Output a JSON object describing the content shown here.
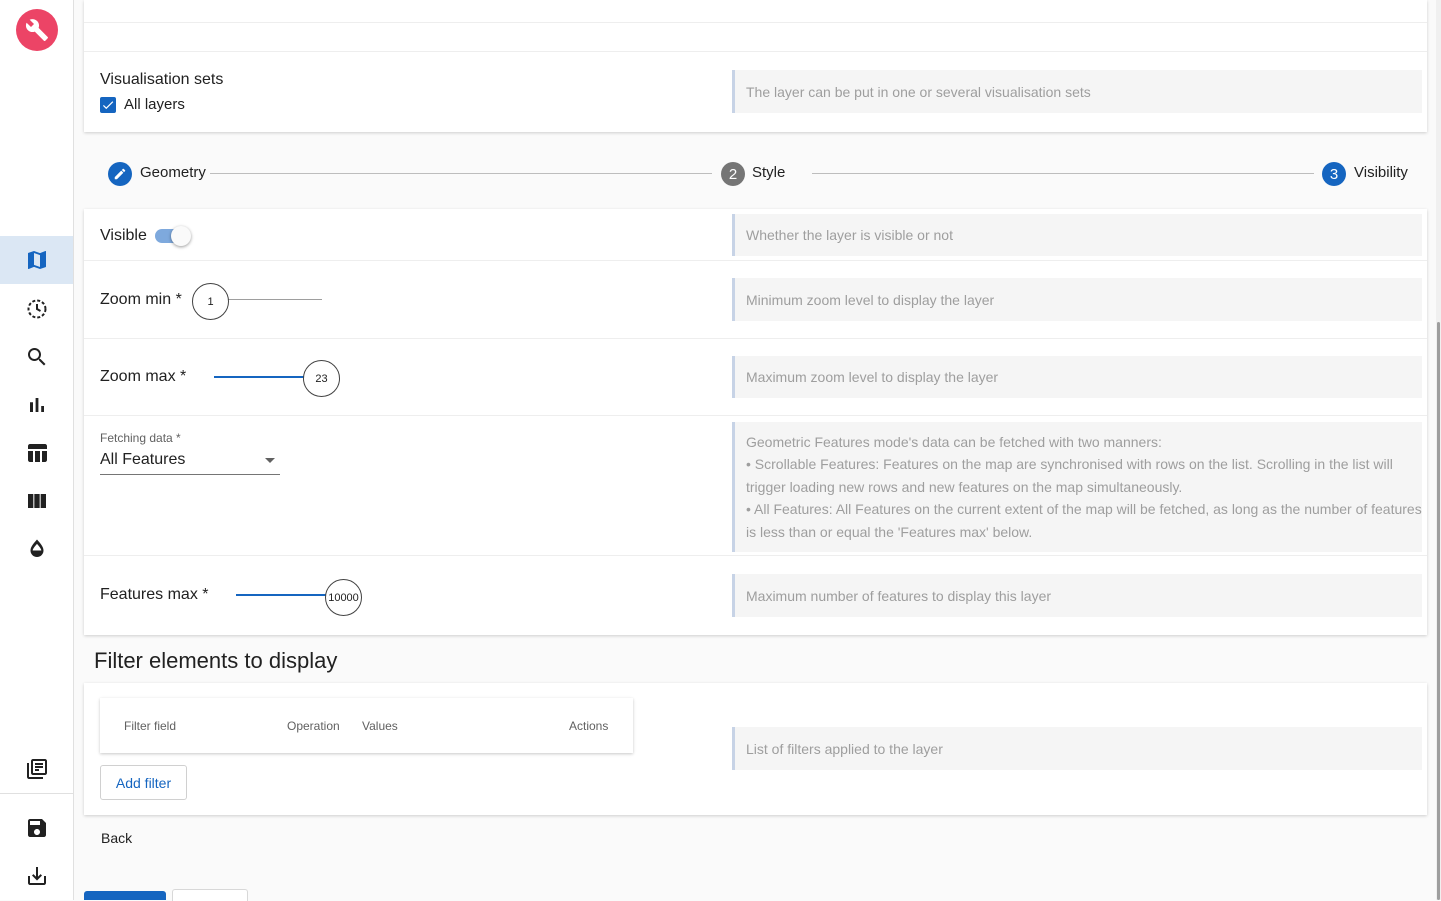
{
  "sidebar": {
    "logo": "wrench-icon",
    "items": [
      {
        "icon": "map-icon",
        "active": true
      },
      {
        "icon": "timeline-icon",
        "active": false
      },
      {
        "icon": "search-icon",
        "active": false
      },
      {
        "icon": "bar-chart-icon",
        "active": false
      },
      {
        "icon": "table-icon",
        "active": false
      },
      {
        "icon": "columns-icon",
        "active": false
      },
      {
        "icon": "color-lens-icon",
        "active": false
      }
    ],
    "bottom_items": [
      {
        "icon": "library-books-icon"
      },
      {
        "icon": "save-icon"
      },
      {
        "icon": "download-icon"
      }
    ]
  },
  "visualisation_sets": {
    "label": "Visualisation sets",
    "option": "All layers",
    "checked": true,
    "help": "The layer can be put in one or several visualisation sets"
  },
  "stepper": {
    "steps": [
      {
        "index": "1",
        "label": "Geometry",
        "state": "edit"
      },
      {
        "index": "2",
        "label": "Style",
        "state": "inactive"
      },
      {
        "index": "3",
        "label": "Visibility",
        "state": "active"
      }
    ]
  },
  "visible": {
    "label": "Visible",
    "on": true,
    "help": "Whether the layer is visible or not"
  },
  "zoom_min": {
    "label": "Zoom min *",
    "value": "1",
    "help": "Minimum zoom level to display the layer"
  },
  "zoom_max": {
    "label": "Zoom max *",
    "value": "23",
    "help": "Maximum zoom level to display the layer"
  },
  "fetching": {
    "label": "Fetching data *",
    "value": "All Features",
    "help_lines": [
      "Geometric Features mode's data can be fetched with two manners:",
      "• Scrollable Features: Features on the map are synchronised with rows on the list. Scrolling in the list will trigger loading new rows and new features on the map simultaneously.",
      "• All Features: All Features on the current extent of the map will be fetched, as long as the number of features is less than or equal the 'Features max' below."
    ]
  },
  "features_max": {
    "label": "Features max *",
    "value": "10000",
    "help": "Maximum number of features to display this layer"
  },
  "filters": {
    "title": "Filter elements to display",
    "columns": [
      "Filter field",
      "Operation",
      "Values",
      "Actions"
    ],
    "add_label": "Add filter",
    "help": "List of filters applied to the layer"
  },
  "footer": {
    "back_label": "Back"
  },
  "colors": {
    "primary": "#1565c0",
    "logo": "#ec4466",
    "active_nav_bg": "#dbe7f4"
  }
}
